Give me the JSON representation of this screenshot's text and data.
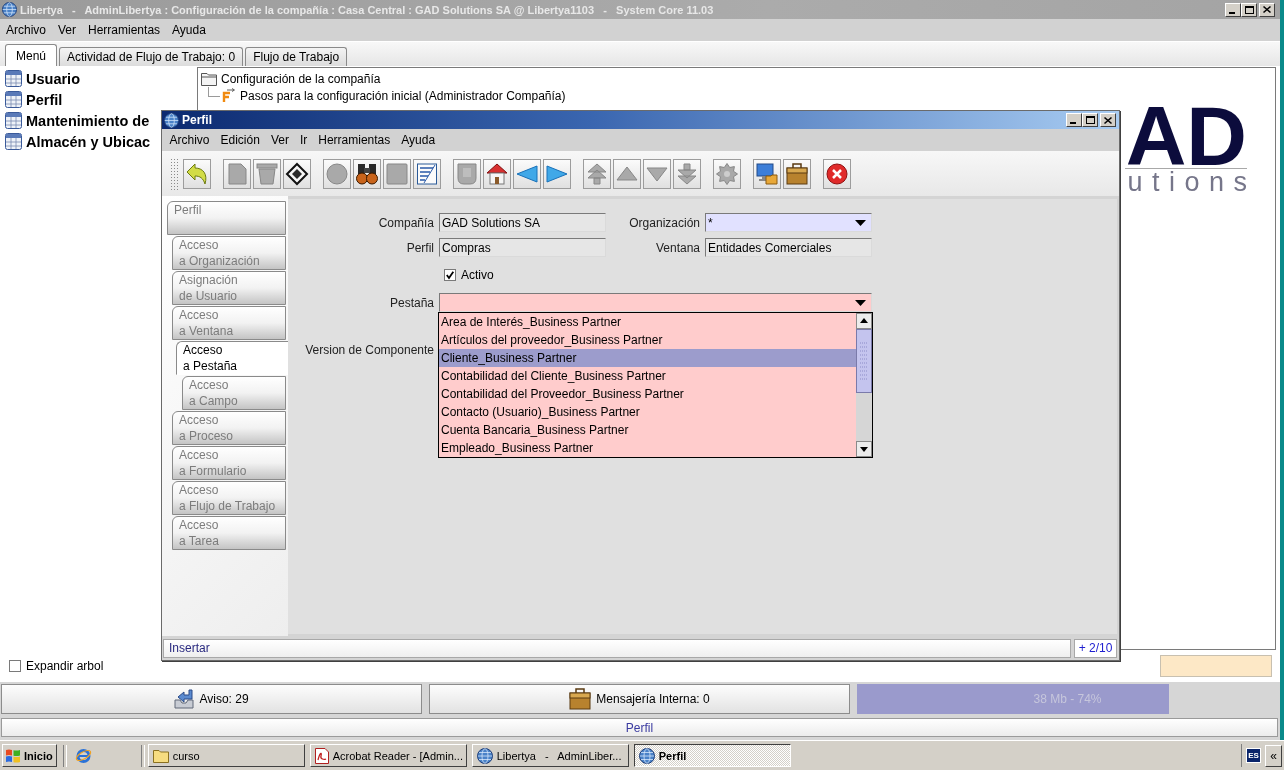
{
  "window": {
    "title": "Libertya   -   AdminLibertya : Configuración de la compañía : Casa Central : GAD Solutions SA @ Libertya1103   -   System Core 11.03"
  },
  "menu": [
    "Archivo",
    "Ver",
    "Herramientas",
    "Ayuda"
  ],
  "tabs": [
    {
      "label": "Menú",
      "selected": true
    },
    {
      "label": "Actividad de Flujo de Trabajo: 0",
      "selected": false
    },
    {
      "label": "Flujo de Trabajo",
      "selected": false
    }
  ],
  "sidebar": {
    "items": [
      "Usuario",
      "Perfil",
      "Mantenimiento de",
      "Almacén y Ubicac"
    ]
  },
  "tree": {
    "items": [
      {
        "label": "Configuración de la compañía",
        "kind": "folder",
        "children": [
          {
            "label": "Pasos para la configuración inicial (Administrador Compañía)",
            "kind": "workflow"
          }
        ]
      }
    ]
  },
  "logo": {
    "mark": "AD",
    "tagline": "utions"
  },
  "expand_tree": {
    "label": "Expandir arbol",
    "checked": false
  },
  "status_buttons": [
    {
      "label": "Aviso: 29",
      "kind": "notice"
    },
    {
      "label": "Mensajería Interna: 0",
      "kind": "messages"
    }
  ],
  "memory": {
    "level": 0.74,
    "reading": "38 Mb - 74%"
  },
  "status_bar": "Perfil",
  "dialog": {
    "title": "Perfil",
    "menu": [
      "Archivo",
      "Edición",
      "Ver",
      "Ir",
      "Herramientas",
      "Ayuda"
    ],
    "toolbar": [
      [
        {
          "kind": "undo",
          "disabled": false
        }
      ],
      [
        {
          "kind": "new",
          "disabled": true
        },
        {
          "kind": "delete",
          "disabled": true
        },
        {
          "kind": "save",
          "disabled": false
        }
      ],
      [
        {
          "kind": "refresh",
          "disabled": true
        },
        {
          "kind": "find",
          "disabled": false
        },
        {
          "kind": "attach",
          "disabled": true
        },
        {
          "kind": "toggle",
          "disabled": false
        }
      ],
      [
        {
          "kind": "history",
          "disabled": true
        },
        {
          "kind": "home",
          "disabled": false
        },
        {
          "kind": "previous",
          "disabled": false
        },
        {
          "kind": "next",
          "disabled": false
        }
      ],
      [
        {
          "kind": "first",
          "disabled": true
        },
        {
          "kind": "up",
          "disabled": true
        },
        {
          "kind": "down",
          "disabled": true
        },
        {
          "kind": "last",
          "disabled": true
        }
      ],
      [
        {
          "kind": "report",
          "disabled": true
        }
      ],
      [
        {
          "kind": "archive",
          "disabled": false
        },
        {
          "kind": "product",
          "disabled": false
        }
      ],
      [
        {
          "kind": "close",
          "disabled": false
        }
      ]
    ],
    "tabs": [
      {
        "label": "Perfil",
        "selected": false,
        "children": [
          {
            "label": "Acceso\na Organización",
            "selected": false
          },
          {
            "label": "Asignación\nde Usuario",
            "selected": false
          },
          {
            "label": "Acceso\na Ventana",
            "selected": false
          },
          {
            "label": "Acceso\na Pestaña",
            "selected": true,
            "children": [
              {
                "label": "Acceso\na Campo",
                "selected": false
              }
            ]
          },
          {
            "label": "Acceso\na Proceso",
            "selected": false
          },
          {
            "label": "Acceso\na Formulario",
            "selected": false
          },
          {
            "label": "Acceso\na Flujo de Trabajo",
            "selected": false
          },
          {
            "label": "Acceso\na Tarea",
            "selected": false
          }
        ]
      }
    ],
    "rows": [
      [
        {
          "kind": "text",
          "label": "Compañía",
          "value": "GAD Solutions SA",
          "readonly": true
        },
        {
          "kind": "combo",
          "label": "Organización",
          "value": "*",
          "readonly": false,
          "mandatory": true
        }
      ],
      [
        {
          "kind": "text",
          "label": "Perfil",
          "value": "Compras",
          "readonly": true
        },
        {
          "kind": "text",
          "label": "Ventana",
          "value": "Entidades Comerciales",
          "readonly": true
        }
      ],
      [
        {
          "kind": "checkbox",
          "label": "Activo",
          "checked": true
        }
      ],
      [
        {
          "kind": "combo",
          "label": "Pestaña",
          "readonly": false,
          "mandatory": true,
          "expanded": true
        }
      ],
      [
        {
          "kind": "label",
          "label": "Version de Componente"
        }
      ]
    ],
    "dropdown": {
      "options": [
        {
          "label": "Area de Interés_Business Partner",
          "selected": false
        },
        {
          "label": "Artículos del proveedor_Business Partner",
          "selected": false
        },
        {
          "label": "Cliente_Business Partner",
          "selected": true
        },
        {
          "label": "Contabilidad del Cliente_Business Partner",
          "selected": false
        },
        {
          "label": "Contabilidad del Proveedor_Business Partner",
          "selected": false
        },
        {
          "label": "Contacto (Usuario)_Business Partner",
          "selected": false
        },
        {
          "label": "Cuenta Bancaria_Business Partner",
          "selected": false
        },
        {
          "label": "Empleado_Business Partner",
          "selected": false
        }
      ]
    },
    "status": {
      "message": "Insertar",
      "record": "+ 2/10"
    }
  },
  "taskbar": {
    "start": "Inicio",
    "tasks": [
      {
        "label": "curso",
        "kind": "folder",
        "selected": false
      },
      {
        "label": "Acrobat Reader - [Admin...",
        "kind": "document",
        "selected": false
      },
      {
        "label": "Libertya   -   AdminLiber...",
        "kind": "app",
        "selected": false
      },
      {
        "label": "Perfil",
        "kind": "app",
        "selected": true
      }
    ],
    "language": "ES",
    "tray_toggle": "«"
  }
}
